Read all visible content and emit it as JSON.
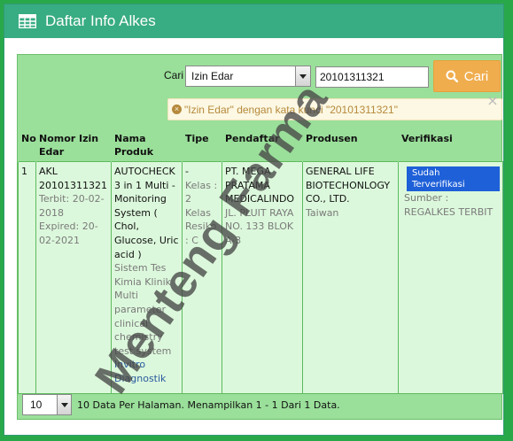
{
  "header": {
    "title": "Daftar Info Alkes",
    "icon": "table-grid-icon"
  },
  "search": {
    "label": "Cari",
    "field_selected": "Izin Edar",
    "field_options": [
      "Izin Edar"
    ],
    "keyword": "20101311321",
    "button_label": "Cari",
    "filter_note": "\"Izin Edar\" dengan kata kunci \"20101311321\"",
    "close_label": "×"
  },
  "table": {
    "columns": [
      "No",
      "Nomor Izin Edar",
      "Nama Produk",
      "Tipe",
      "Pendaftar",
      "Produsen",
      "Verifikasi"
    ],
    "rows": [
      {
        "no": "1",
        "nomor_izin": "AKL 20101311321",
        "terbit": "Terbit: 20-02-2018",
        "expired": "Expired: 20-02-2021",
        "nama_produk": "AUTOCHECK 3 in 1 Multi - Monitoring System ( Chol, Glucose, Uric acid )",
        "kategori": "Sistem Tes Kimia Klinik Multi parameter clinical chemistry test system",
        "jenis": "Invitro Diagnostik",
        "tipe_dash": "-",
        "tipe": "Kelas : 2 Kelas Resiko : C",
        "pendaftar": "PT. MEGA PRATAMA MEDICALINDO",
        "pendaftar_alamat": "JL. PLUIT RAYA NO. 133 BLOK A-3",
        "produsen": "GENERAL LIFE BIOTECHONLOGY CO., LTD.",
        "produsen_negara": "Taiwan",
        "verifikasi_badge": "Sudah Terverifikasi",
        "verifikasi_sumber": "Sumber : REGALKES TERBIT"
      }
    ]
  },
  "pager": {
    "per_page": "10",
    "summary": "10 Data Per Halaman. Menampilkan 1 - 1 Dari 1 Data."
  },
  "watermark": "Menteng Farma",
  "colors": {
    "page_bg": "#29a84a",
    "header_bg": "#38ac82",
    "inner_bg": "#9adf9a",
    "row_bg": "#dcf8dc",
    "button": "#f0ad4e",
    "badge": "#1e60d8"
  }
}
